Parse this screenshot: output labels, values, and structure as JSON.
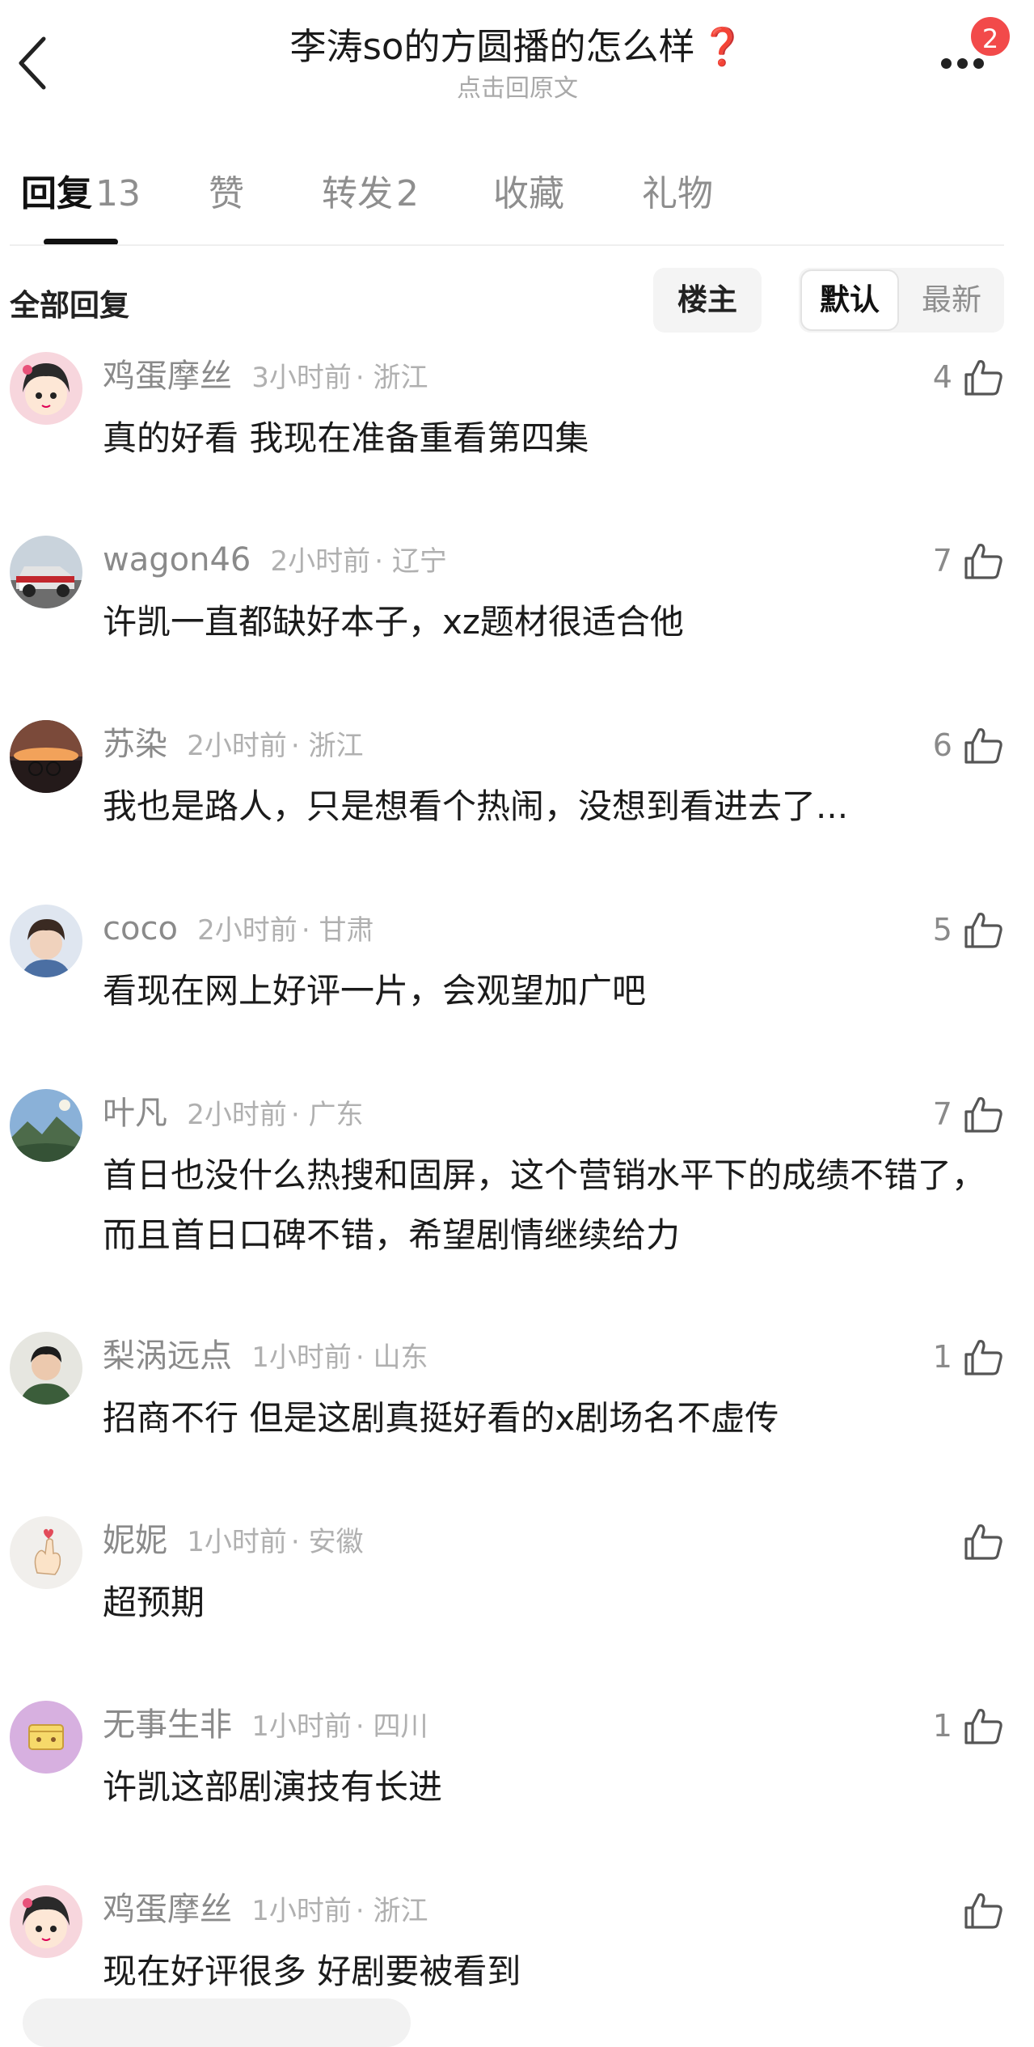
{
  "header": {
    "title": "李涛so的方圆播的怎么样",
    "title_suffix": "❓",
    "subtitle": "点击回原文",
    "badge_count": "2"
  },
  "tabs": [
    {
      "label": "回复",
      "count": "13"
    },
    {
      "label": "赞",
      "count": ""
    },
    {
      "label": "转发",
      "count": "2"
    },
    {
      "label": "收藏",
      "count": ""
    },
    {
      "label": "礼物",
      "count": ""
    }
  ],
  "filter": {
    "all_label": "全部回复",
    "owner_label": "楼主",
    "sort_default": "默认",
    "sort_newest": "最新"
  },
  "comments": [
    {
      "user": "鸡蛋摩丝",
      "time": "3小时前",
      "location": "浙江",
      "text": "真的好看 我现在准备重看第四集",
      "likes": "4",
      "avatar": "cartoon-girl"
    },
    {
      "user": "wagon46",
      "time": "2小时前",
      "location": "辽宁",
      "text": "许凯一直都缺好本子，xz题材很适合他",
      "likes": "7",
      "avatar": "race-car"
    },
    {
      "user": "苏染",
      "time": "2小时前",
      "location": "浙江",
      "text": "我也是路人，只是想看个热闹，没想到看进去了...",
      "likes": "6",
      "avatar": "sunset-bike"
    },
    {
      "user": "coco",
      "time": "2小时前",
      "location": "甘肃",
      "text": "看现在网上好评一片，会观望加广吧",
      "likes": "5",
      "avatar": "portrait"
    },
    {
      "user": "叶凡",
      "time": "2小时前",
      "location": "广东",
      "text": "首日也没什么热搜和固屏，这个营销水平下的成绩不错了，而且首日口碑不错，希望剧情继续给力",
      "likes": "7",
      "avatar": "landscape"
    },
    {
      "user": "梨涡远点",
      "time": "1小时前",
      "location": "山东",
      "text": "招商不行 但是这剧真挺好看的x剧场名不虚传",
      "likes": "1",
      "avatar": "man-portrait"
    },
    {
      "user": "妮妮",
      "time": "1小时前",
      "location": "安徽",
      "text": "超预期",
      "likes": "",
      "avatar": "hand-heart"
    },
    {
      "user": "无事生非",
      "time": "1小时前",
      "location": "四川",
      "text": "许凯这部剧演技有长进",
      "likes": "1",
      "avatar": "purple-box"
    },
    {
      "user": "鸡蛋摩丝",
      "time": "1小时前",
      "location": "浙江",
      "text": "现在好评很多 好剧要被看到",
      "likes": "",
      "avatar": "cartoon-girl"
    }
  ],
  "colors": {
    "accent": "#111111",
    "badge": "#f24a4a",
    "muted": "#8a8a8a",
    "title_mark": "#e0312f"
  }
}
